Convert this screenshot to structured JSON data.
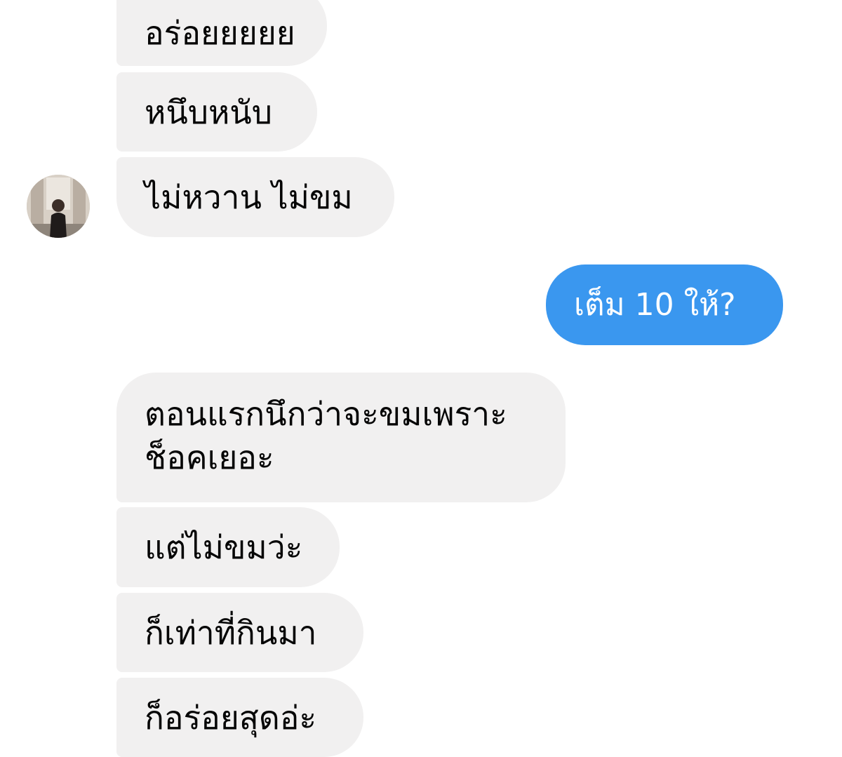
{
  "conversation": {
    "contact_avatar": "contact-profile-photo",
    "messages": [
      {
        "sender": "contact",
        "text": "อร่อยยยยย"
      },
      {
        "sender": "contact",
        "text": "หนึบหนับ"
      },
      {
        "sender": "contact",
        "text": "ไม่หวาน ไม่ขม"
      },
      {
        "sender": "me",
        "text": "เต็ม 10 ให้?"
      },
      {
        "sender": "contact",
        "text": "ตอนแรกนึกว่าจะขมเพราะช็อคเยอะ"
      },
      {
        "sender": "contact",
        "text": "แต่ไม่ขมว่ะ"
      },
      {
        "sender": "contact",
        "text": "ก็เท่าที่กินมา"
      },
      {
        "sender": "contact",
        "text": "ก็อร่อยสุดอ่ะ"
      }
    ]
  },
  "colors": {
    "incoming_bubble": "#f1f0f0",
    "outgoing_bubble": "#3a97ef",
    "incoming_text": "#050505",
    "outgoing_text": "#ffffff"
  }
}
